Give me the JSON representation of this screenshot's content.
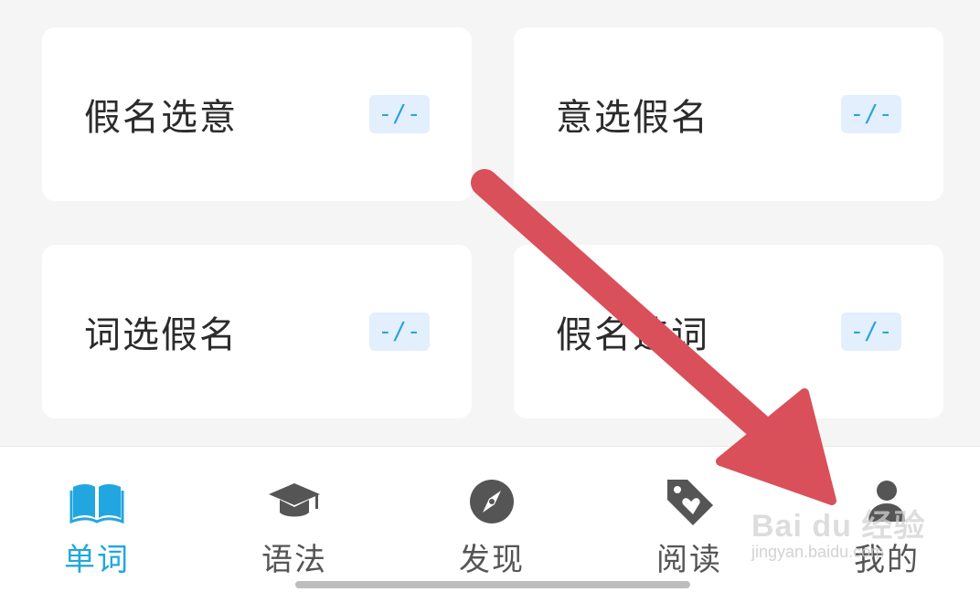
{
  "cards": [
    {
      "title": "假名选意",
      "badge": "-/-"
    },
    {
      "title": "意选假名",
      "badge": "-/-"
    },
    {
      "title": "词选假名",
      "badge": "-/-"
    },
    {
      "title": "假名选词",
      "badge": "-/-"
    }
  ],
  "tabbar": {
    "active_index": 0,
    "tabs": [
      {
        "label": "单词",
        "icon": "book-icon"
      },
      {
        "label": "语法",
        "icon": "graduation-cap-icon"
      },
      {
        "label": "发现",
        "icon": "compass-icon"
      },
      {
        "label": "阅读",
        "icon": "heart-tag-icon"
      },
      {
        "label": "我的",
        "icon": "user-icon"
      }
    ]
  },
  "colors": {
    "accent": "#22a6df",
    "badge_bg": "#e3effc",
    "arrow": "#d9505a",
    "background": "#f5f5f5"
  },
  "watermark": {
    "logo": "Bai du 经验",
    "url": "jingyan.baidu.com"
  }
}
